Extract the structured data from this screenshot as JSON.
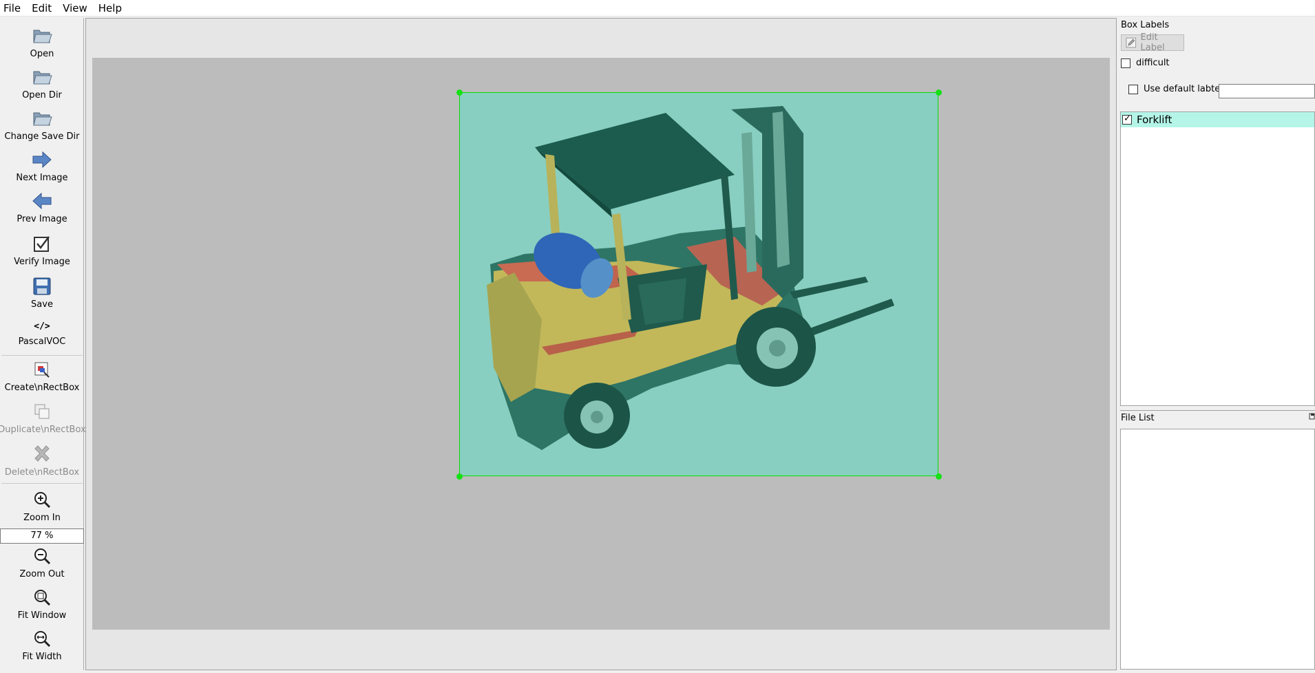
{
  "menu": [
    "File",
    "Edit",
    "View",
    "Help"
  ],
  "toolbar": {
    "open": "Open",
    "open_dir": "Open Dir",
    "change_save_dir": "Change Save Dir",
    "next_image": "Next Image",
    "prev_image": "Prev Image",
    "verify_image": "Verify Image",
    "save": "Save",
    "format": "PascalVOC",
    "format_icon": "</>",
    "create_rect": "Create\\nRectBox",
    "duplicate_rect": "Duplicate\\nRectBox",
    "delete_rect": "Delete\\nRectBox",
    "zoom_in": "Zoom In",
    "zoom_value": "77 %",
    "zoom_out": "Zoom Out",
    "fit_window": "Fit Window",
    "fit_width": "Fit Width"
  },
  "box_labels": {
    "title": "Box Labels",
    "edit_label": "Edit Label",
    "difficult": "difficult",
    "use_default": "Use default labtel",
    "default_value": "",
    "items": [
      {
        "label": "Forklift",
        "checked": true
      }
    ]
  },
  "file_list": {
    "title": "File List",
    "items": []
  },
  "annotation": {
    "label": "Forklift",
    "box_color": "#00e000",
    "fill_color": "#88cfc1"
  }
}
